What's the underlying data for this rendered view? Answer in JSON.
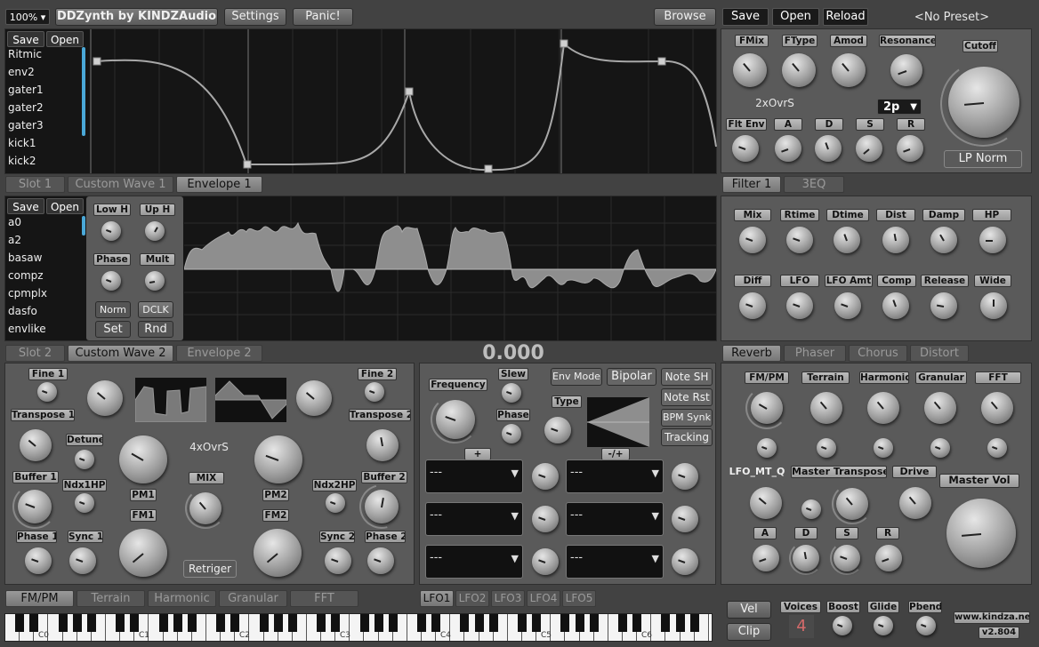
{
  "topbar": {
    "zoom": "100%",
    "title": "DDZynth by KINDZAudio",
    "settings": "Settings",
    "panic": "Panic!",
    "browse": "Browse",
    "save": "Save",
    "open": "Open",
    "reload": "Reload",
    "preset": "<No Preset>"
  },
  "env_editor": {
    "save": "Save",
    "open": "Open",
    "items": [
      "Ritmic",
      "env2",
      "gater1",
      "gater2",
      "gater3",
      "kick1",
      "kick2"
    ]
  },
  "slot_tabs": [
    "Slot 1",
    "Custom Wave 1",
    "Envelope 1"
  ],
  "wave_editor": {
    "save": "Save",
    "open": "Open",
    "items": [
      "a0",
      "a2",
      "basaw",
      "compz",
      "cpmplx",
      "dasfo",
      "envlike"
    ],
    "low_h": "Low H",
    "up_h": "Up H",
    "phase": "Phase",
    "mult": "Mult",
    "norm": "Norm",
    "dclk": "DCLK",
    "set": "Set",
    "rnd": "Rnd"
  },
  "slot_tabs2": [
    "Slot 2",
    "Custom Wave 2",
    "Envelope 2"
  ],
  "value_readout": "0.000",
  "filter": {
    "fmix": "FMix",
    "ftype": "FType",
    "amod": "Amod",
    "resonance": "Resonance",
    "cutoff": "Cutoff",
    "oversample": "2xOvrS",
    "mode": "2p",
    "flt_env": "Flt Env",
    "a": "A",
    "d": "D",
    "s": "S",
    "r": "R",
    "lp_norm": "LP Norm"
  },
  "filter_tabs": [
    "Filter 1",
    "3EQ"
  ],
  "reverb": {
    "labels_row1": [
      "Mix",
      "Rtime",
      "Dtime",
      "Dist",
      "Damp",
      "HP"
    ],
    "labels_row2": [
      "Diff",
      "LFO",
      "LFO Amt",
      "Comp",
      "Release",
      "Wide"
    ]
  },
  "fx_tabs": [
    "Reverb",
    "Phaser",
    "Chorus",
    "Distort"
  ],
  "osc": {
    "fine1": "Fine 1",
    "fine2": "Fine 2",
    "transpose1": "Transpose 1",
    "transpose2": "Transpose 2",
    "detune": "Detune",
    "oversample": "4xOvrS",
    "buffer1": "Buffer 1",
    "buffer2": "Buffer 2",
    "ndx1hp": "Ndx1HP",
    "ndx2hp": "Ndx2HP",
    "pm1": "PM1",
    "pm2": "PM2",
    "mix": "MIX",
    "fm1": "FM1",
    "fm2": "FM2",
    "phase1": "Phase 1",
    "sync1": "Sync 1",
    "sync2": "Sync 2",
    "phase2": "Phase 2",
    "retrigger": "Retriger"
  },
  "lfo": {
    "frequency": "Frequency",
    "slew": "Slew",
    "phase": "Phase",
    "type": "Type",
    "env_mode": "Env Mode",
    "bipolar": "Bipolar",
    "note_sh": "Note SH",
    "note_rst": "Note Rst",
    "bpm_synk": "BPM Synk",
    "tracking": "Tracking",
    "plus": "+",
    "minus_plus": "-/+",
    "slot": "---"
  },
  "lfo_tabs": [
    "LFO1",
    "LFO2",
    "LFO3",
    "LFO4",
    "LFO5"
  ],
  "osc_tabs": [
    "FM/PM",
    "Terrain",
    "Harmonic",
    "Granular",
    "FFT"
  ],
  "master": {
    "fmpm": "FM/PM",
    "terrain": "Terrain",
    "harmonic": "Harmonic",
    "granular": "Granular",
    "fft": "FFT",
    "lfo_mt_q": "LFO_MT_Q",
    "master_transpose": "Master Transpose",
    "drive": "Drive",
    "master_vol": "Master Vol",
    "a": "A",
    "d": "D",
    "s": "S",
    "r": "R"
  },
  "bottom": {
    "vel": "Vel",
    "clip": "Clip",
    "voices": "Voices",
    "voices_val": "4",
    "boost": "Boost",
    "glide": "Glide",
    "pbend": "Pbend",
    "url": "www.kindza.net",
    "version": "v2.804"
  },
  "keyboard": {
    "octaves": [
      "C0",
      "C1",
      "C2",
      "C3",
      "C4",
      "C5",
      "C6"
    ]
  }
}
